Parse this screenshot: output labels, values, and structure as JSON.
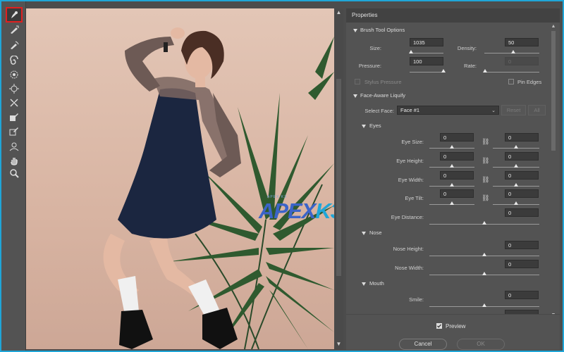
{
  "toolbar": {
    "tools": [
      {
        "name": "forward-warp-tool",
        "icon": "warp-brush-icon",
        "active": true
      },
      {
        "name": "reconstruct-tool",
        "icon": "reconstruct-brush-icon"
      },
      {
        "name": "smooth-tool",
        "icon": "smooth-brush-icon"
      },
      {
        "name": "twirl-clockwise-tool",
        "icon": "twirl-icon"
      },
      {
        "name": "pucker-tool",
        "icon": "pucker-icon"
      },
      {
        "name": "bloat-tool",
        "icon": "bloat-icon"
      },
      {
        "name": "push-left-tool",
        "icon": "push-left-icon"
      },
      {
        "name": "freeze-mask-tool",
        "icon": "freeze-mask-icon"
      },
      {
        "name": "thaw-mask-tool",
        "icon": "thaw-mask-icon"
      },
      {
        "name": "face-tool",
        "icon": "face-icon"
      },
      {
        "name": "hand-tool",
        "icon": "hand-icon"
      },
      {
        "name": "zoom-tool",
        "icon": "zoom-icon"
      }
    ],
    "active_color": "#e02020"
  },
  "canvas": {
    "watermark": {
      "small": "APEX K3",
      "part1": "APEX",
      "part2": "K3"
    }
  },
  "panel": {
    "title": "Properties",
    "brush_section": "Brush Tool Options",
    "brush": {
      "size_label": "Size:",
      "size_value": "1035",
      "density_label": "Density:",
      "density_value": "50",
      "pressure_label": "Pressure:",
      "pressure_value": "100",
      "rate_label": "Rate:",
      "rate_value": "0",
      "stylus_label": "Stylus Pressure",
      "pin_edges_label": "Pin Edges"
    },
    "face_section": "Face-Aware Liquify",
    "select_face_label": "Select Face:",
    "select_face_value": "Face #1",
    "reset_label": "Reset",
    "all_label": "All",
    "eyes_section": "Eyes",
    "eyes": {
      "size_label": "Eye Size:",
      "size_left": "0",
      "size_right": "0",
      "height_label": "Eye Height:",
      "height_left": "0",
      "height_right": "0",
      "width_label": "Eye Width:",
      "width_left": "0",
      "width_right": "0",
      "tilt_label": "Eye Tilt:",
      "tilt_left": "0",
      "tilt_right": "0",
      "distance_label": "Eye Distance:",
      "distance_value": "0"
    },
    "nose_section": "Nose",
    "nose": {
      "height_label": "Nose Height:",
      "height_value": "0",
      "width_label": "Nose Width:",
      "width_value": "0"
    },
    "mouth_section": "Mouth",
    "mouth": {
      "smile_label": "Smile:",
      "smile_value": "0"
    },
    "preview_label": "Preview",
    "cancel_label": "Cancel",
    "ok_label": "OK"
  },
  "colors": {
    "frame": "#1fa6d8",
    "panel": "#535353",
    "canvas_bg": "#d8b4a2"
  }
}
